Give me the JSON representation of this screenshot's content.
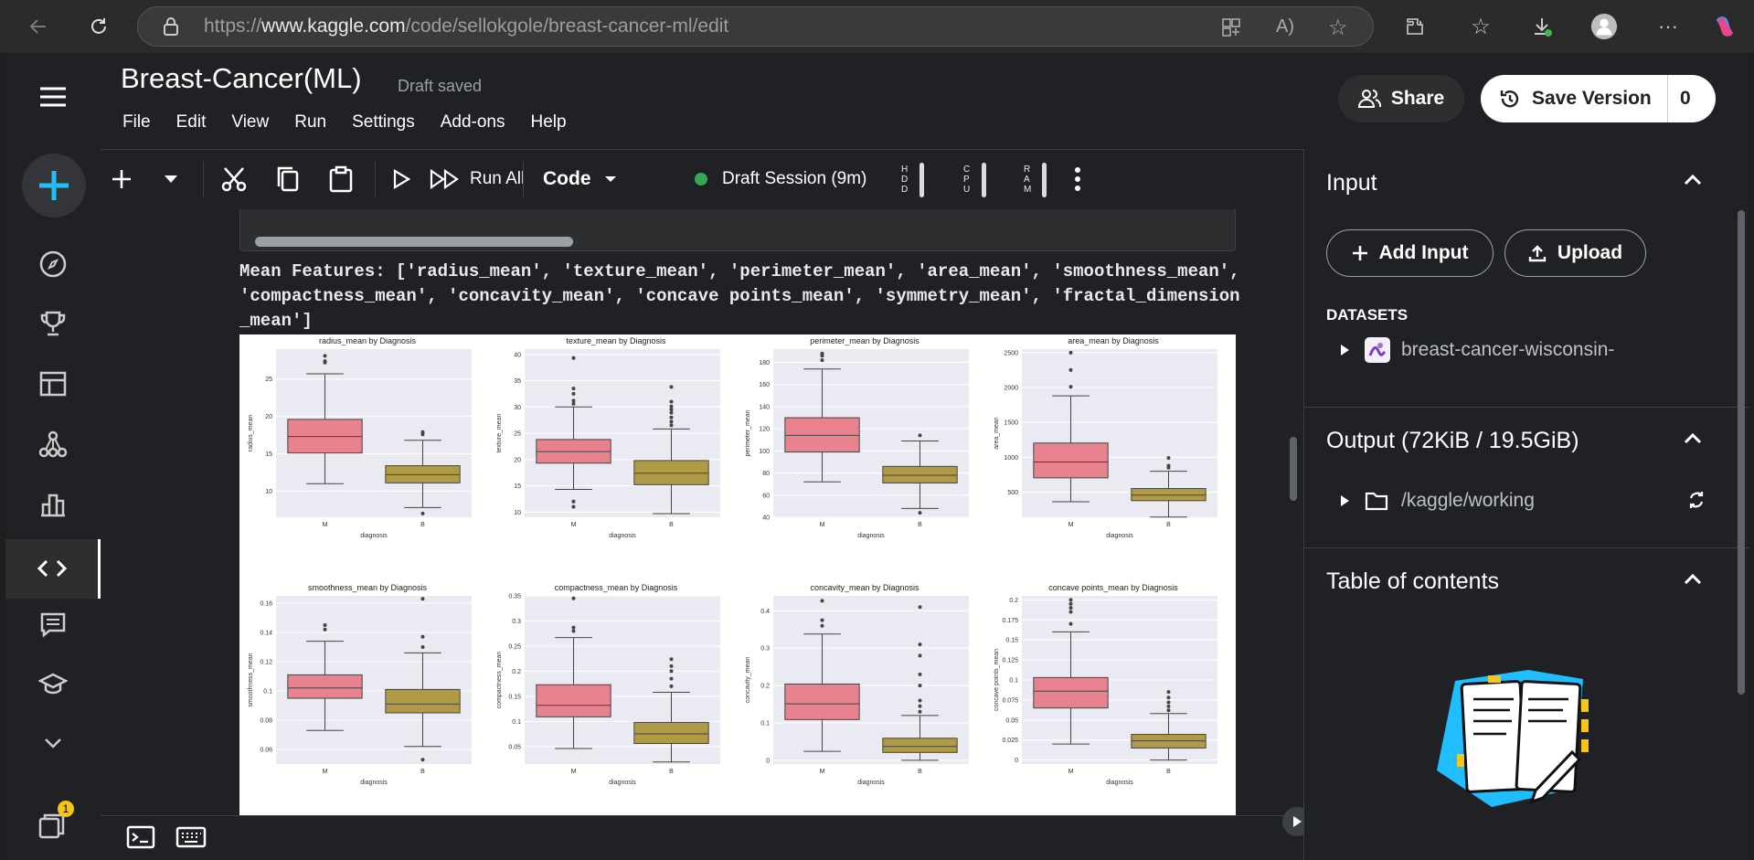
{
  "browser": {
    "url_prefix": "https://",
    "url_domain": "www.kaggle.com",
    "url_path": "/code/sellokgole/breast-cancer-ml/edit"
  },
  "header": {
    "title": "Breast-Cancer(ML)",
    "status": "Draft saved",
    "menu": [
      "File",
      "Edit",
      "View",
      "Run",
      "Settings",
      "Add-ons",
      "Help"
    ],
    "share_label": "Share",
    "save_label": "Save Version",
    "save_count": "0"
  },
  "toolbar": {
    "run_all_label": "Run All",
    "cell_type": "Code",
    "session_label": "Draft Session (9m)",
    "hdd": "HDD",
    "cpu": "CPU",
    "ram": "RAM",
    "session_color": "#34a853"
  },
  "cell": {
    "code_hint": "",
    "output_text": "Mean Features: ['radius_mean', 'texture_mean', 'perimeter_mean', 'area_mean', 'smoothness_mean', 'compactness_mean', 'concavity_mean', 'concave points_mean', 'symmetry_mean', 'fractal_dimension_mean']"
  },
  "right_panel": {
    "input_title": "Input",
    "add_input_label": "Add Input",
    "upload_label": "Upload",
    "datasets_label": "DATASETS",
    "dataset_name": "breast-cancer-wisconsin-",
    "output_title": "Output (72KiB / 19.5GiB)",
    "output_path": "/kaggle/working",
    "toc_title": "Table of contents"
  },
  "leftnav": {
    "badge_count": "1"
  },
  "colors": {
    "malignant": "#e8828f",
    "benign": "#b09a45",
    "plot_bg": "#eaeaf2",
    "accent_blue": "#20beff"
  },
  "chart_data": [
    {
      "type": "box",
      "title": "radius_mean by Diagnosis",
      "xlabel": "diagnosis",
      "ylabel": "radius_mean",
      "categories": [
        "M",
        "B"
      ],
      "yticks": [
        10,
        15,
        20,
        25
      ],
      "ylim": [
        6.5,
        29
      ],
      "boxes": [
        {
          "q1": 15.1,
          "median": 17.3,
          "q3": 19.6,
          "whislo": 11,
          "whishi": 25.7,
          "fliers": [
            27.2,
            27.4,
            28.1
          ]
        },
        {
          "q1": 11.1,
          "median": 12.2,
          "q3": 13.4,
          "whislo": 7.8,
          "whishi": 16.8,
          "fliers": [
            17.6,
            17.9,
            7.0
          ]
        }
      ]
    },
    {
      "type": "box",
      "title": "texture_mean by Diagnosis",
      "xlabel": "diagnosis",
      "ylabel": "texture_mean",
      "categories": [
        "M",
        "B"
      ],
      "yticks": [
        10,
        15,
        20,
        25,
        30,
        35,
        40
      ],
      "ylim": [
        9,
        41
      ],
      "boxes": [
        {
          "q1": 19.3,
          "median": 21.5,
          "q3": 23.8,
          "whislo": 14.3,
          "whishi": 30,
          "fliers": [
            30.6,
            31.2,
            32.5,
            33.5,
            39.3,
            11.0,
            12.0
          ]
        },
        {
          "q1": 15.2,
          "median": 17.4,
          "q3": 19.8,
          "whislo": 9.7,
          "whishi": 25.8,
          "fliers": [
            26.5,
            27.2,
            28,
            28.9,
            29.5,
            30.1,
            31,
            33.8
          ]
        }
      ]
    },
    {
      "type": "box",
      "title": "perimeter_mean by Diagnosis",
      "xlabel": "diagnosis",
      "ylabel": "perimeter_mean",
      "categories": [
        "M",
        "B"
      ],
      "yticks": [
        40,
        60,
        80,
        100,
        120,
        140,
        160,
        180
      ],
      "ylim": [
        40,
        192
      ],
      "boxes": [
        {
          "q1": 99,
          "median": 114,
          "q3": 130,
          "whislo": 72,
          "whishi": 174,
          "fliers": [
            182,
            186,
            188
          ]
        },
        {
          "q1": 71,
          "median": 78,
          "q3": 86,
          "whislo": 48,
          "whishi": 109,
          "fliers": [
            114,
            44
          ]
        }
      ]
    },
    {
      "type": "box",
      "title": "area_mean by Diagnosis",
      "xlabel": "diagnosis",
      "ylabel": "area_mean",
      "categories": [
        "M",
        "B"
      ],
      "yticks": [
        500,
        1000,
        1500,
        2000,
        2500
      ],
      "ylim": [
        140,
        2550
      ],
      "boxes": [
        {
          "q1": 705,
          "median": 932,
          "q3": 1204,
          "whislo": 362,
          "whishi": 1880,
          "fliers": [
            2010,
            2250,
            2500
          ]
        },
        {
          "q1": 378,
          "median": 458,
          "q3": 552,
          "whislo": 144,
          "whishi": 800,
          "fliers": [
            850,
            880,
            990
          ]
        }
      ]
    },
    {
      "type": "box",
      "title": "smoothness_mean by Diagnosis",
      "xlabel": "diagnosis",
      "ylabel": "smoothness_mean",
      "categories": [
        "M",
        "B"
      ],
      "yticks": [
        0.06,
        0.08,
        0.1,
        0.12,
        0.14,
        0.16
      ],
      "ylim": [
        0.05,
        0.165
      ],
      "boxes": [
        {
          "q1": 0.095,
          "median": 0.102,
          "q3": 0.111,
          "whislo": 0.073,
          "whishi": 0.134,
          "fliers": [
            0.142,
            0.145
          ]
        },
        {
          "q1": 0.085,
          "median": 0.091,
          "q3": 0.101,
          "whislo": 0.062,
          "whishi": 0.126,
          "fliers": [
            0.13,
            0.137,
            0.163,
            0.053
          ]
        }
      ]
    },
    {
      "type": "box",
      "title": "compactness_mean by Diagnosis",
      "xlabel": "diagnosis",
      "ylabel": "compactness_mean",
      "categories": [
        "M",
        "B"
      ],
      "yticks": [
        0.05,
        0.1,
        0.15,
        0.2,
        0.25,
        0.3,
        0.35
      ],
      "ylim": [
        0.015,
        0.35
      ],
      "boxes": [
        {
          "q1": 0.109,
          "median": 0.132,
          "q3": 0.173,
          "whislo": 0.046,
          "whishi": 0.267,
          "fliers": [
            0.28,
            0.287,
            0.345
          ]
        },
        {
          "q1": 0.056,
          "median": 0.075,
          "q3": 0.098,
          "whislo": 0.019,
          "whishi": 0.158,
          "fliers": [
            0.17,
            0.185,
            0.2,
            0.21,
            0.224
          ]
        }
      ]
    },
    {
      "type": "box",
      "title": "concavity_mean by Diagnosis",
      "xlabel": "diagnosis",
      "ylabel": "concavity_mean",
      "categories": [
        "M",
        "B"
      ],
      "yticks": [
        0.0,
        0.1,
        0.2,
        0.3,
        0.4
      ],
      "ylim": [
        -0.01,
        0.44
      ],
      "boxes": [
        {
          "q1": 0.109,
          "median": 0.151,
          "q3": 0.204,
          "whislo": 0.024,
          "whishi": 0.338,
          "fliers": [
            0.36,
            0.375,
            0.427
          ]
        },
        {
          "q1": 0.021,
          "median": 0.037,
          "q3": 0.059,
          "whislo": 0.0,
          "whishi": 0.12,
          "fliers": [
            0.13,
            0.145,
            0.16,
            0.2,
            0.23,
            0.28,
            0.31,
            0.41
          ]
        }
      ]
    },
    {
      "type": "box",
      "title": "concave points_mean by Diagnosis",
      "xlabel": "diagnosis",
      "ylabel": "concave points_mean",
      "categories": [
        "M",
        "B"
      ],
      "yticks": [
        0.0,
        0.025,
        0.05,
        0.075,
        0.1,
        0.125,
        0.15,
        0.175,
        0.2
      ],
      "ylim": [
        -0.005,
        0.205
      ],
      "boxes": [
        {
          "q1": 0.065,
          "median": 0.086,
          "q3": 0.103,
          "whislo": 0.02,
          "whishi": 0.16,
          "fliers": [
            0.17,
            0.185,
            0.19,
            0.195,
            0.2
          ]
        },
        {
          "q1": 0.015,
          "median": 0.024,
          "q3": 0.032,
          "whislo": 0.0,
          "whishi": 0.058,
          "fliers": [
            0.062,
            0.067,
            0.072,
            0.078,
            0.085
          ]
        }
      ]
    }
  ]
}
